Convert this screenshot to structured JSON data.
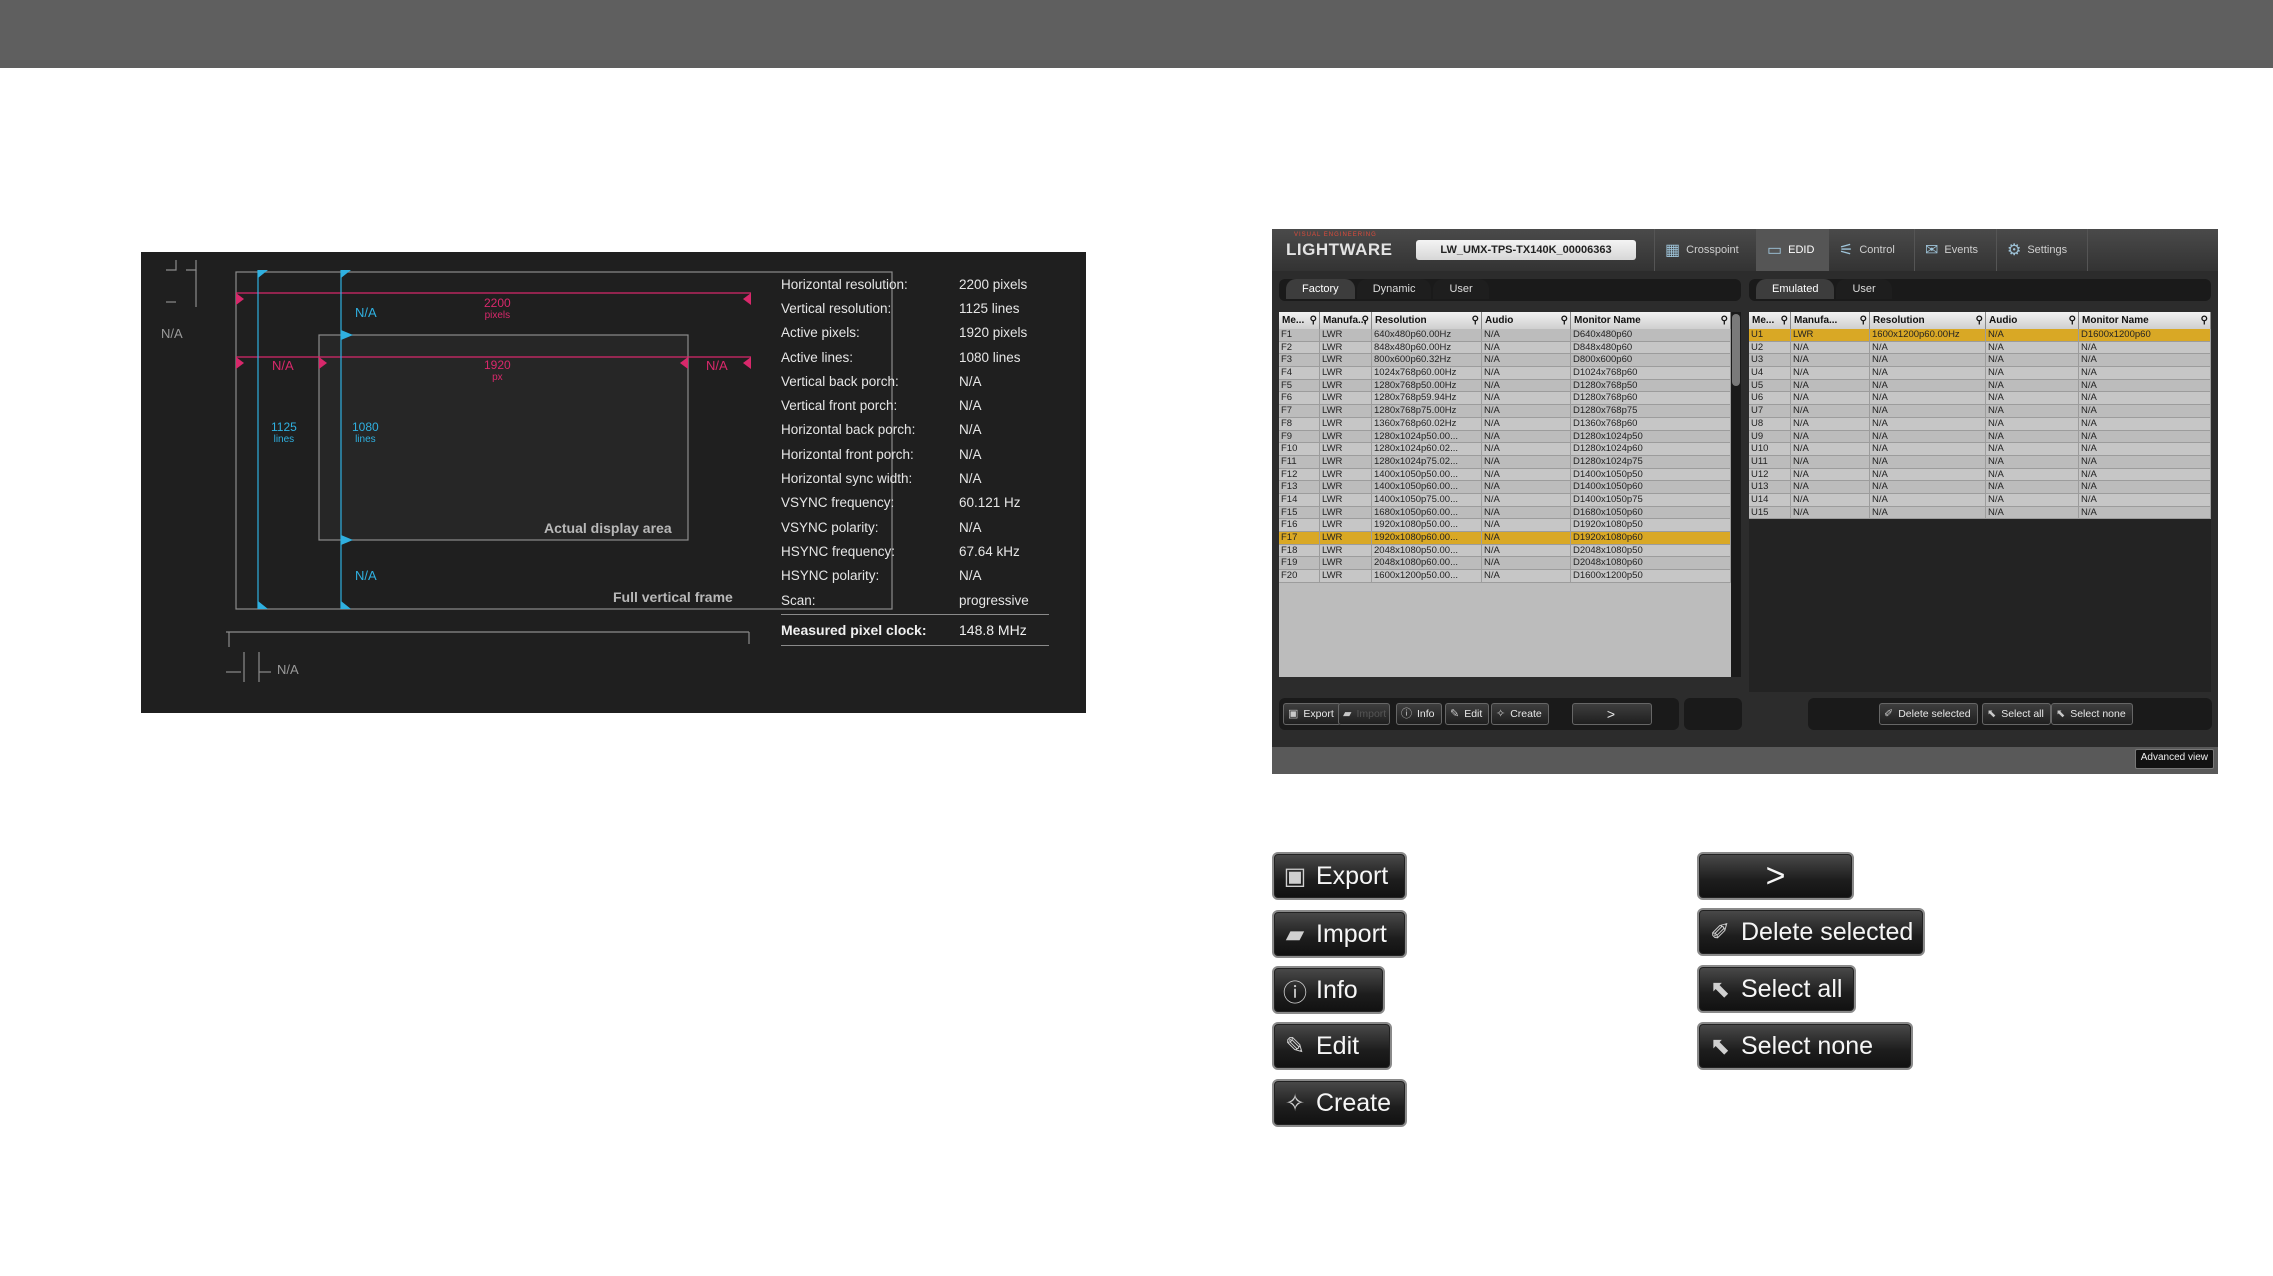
{
  "timing": {
    "labels": {
      "h_total": "2200",
      "h_total_unit": "pixels",
      "h_active": "1920",
      "h_active_unit": "px",
      "v_total": "1125",
      "v_total_unit": "lines",
      "v_active": "1080",
      "v_active_unit": "lines",
      "na": "N/A",
      "actual_area": "Actual display area",
      "full_frame": "Full vertical frame"
    },
    "params": [
      {
        "k": "Horizontal resolution:",
        "v": "2200 pixels"
      },
      {
        "k": "Vertical resolution:",
        "v": "1125 lines"
      },
      {
        "k": "Active pixels:",
        "v": "1920 pixels"
      },
      {
        "k": "Active lines:",
        "v": "1080 lines"
      },
      {
        "k": "Vertical back porch:",
        "v": "N/A"
      },
      {
        "k": "Vertical front porch:",
        "v": "N/A"
      },
      {
        "k": "Horizontal back porch:",
        "v": "N/A"
      },
      {
        "k": "Horizontal front porch:",
        "v": "N/A"
      },
      {
        "k": "Horizontal sync width:",
        "v": "N/A"
      },
      {
        "k": "VSYNC frequency:",
        "v": "60.121 Hz"
      },
      {
        "k": "VSYNC polarity:",
        "v": "N/A"
      },
      {
        "k": "HSYNC frequency:",
        "v": "67.64 kHz"
      },
      {
        "k": "HSYNC polarity:",
        "v": "N/A"
      },
      {
        "k": "Scan:",
        "v": "progressive"
      }
    ],
    "pixel_clock": {
      "k": "Measured pixel clock:",
      "v": "148.8 MHz"
    }
  },
  "app": {
    "logo": "LIGHTWARE",
    "logo_tagline": "VISUAL ENGINEERING",
    "device": "LW_UMX-TPS-TX140K_00006363",
    "nav": [
      {
        "label": "Crosspoint",
        "icon": "crosspoint-icon",
        "glyph": "▦"
      },
      {
        "label": "EDID",
        "icon": "monitor-icon",
        "glyph": "▭"
      },
      {
        "label": "Control",
        "icon": "control-icon",
        "glyph": "⚟"
      },
      {
        "label": "Events",
        "icon": "events-icon",
        "glyph": "✉"
      },
      {
        "label": "Settings",
        "icon": "gear-icon",
        "glyph": "⚙"
      }
    ],
    "left_tabs": [
      "Factory",
      "Dynamic",
      "User"
    ],
    "right_tabs": [
      "Emulated",
      "User"
    ],
    "left_columns": [
      "Me...",
      "Manufa...",
      "Resolution",
      "Audio",
      "Monitor Name"
    ],
    "right_columns": [
      "Me...",
      "Manufa...",
      "Resolution",
      "Audio",
      "Monitor Name"
    ],
    "left_rows": [
      [
        "F1",
        "LWR",
        "640x480p60.00Hz",
        "N/A",
        "D640x480p60"
      ],
      [
        "F2",
        "LWR",
        "848x480p60.00Hz",
        "N/A",
        "D848x480p60"
      ],
      [
        "F3",
        "LWR",
        "800x600p60.32Hz",
        "N/A",
        "D800x600p60"
      ],
      [
        "F4",
        "LWR",
        "1024x768p60.00Hz",
        "N/A",
        "D1024x768p60"
      ],
      [
        "F5",
        "LWR",
        "1280x768p50.00Hz",
        "N/A",
        "D1280x768p50"
      ],
      [
        "F6",
        "LWR",
        "1280x768p59.94Hz",
        "N/A",
        "D1280x768p60"
      ],
      [
        "F7",
        "LWR",
        "1280x768p75.00Hz",
        "N/A",
        "D1280x768p75"
      ],
      [
        "F8",
        "LWR",
        "1360x768p60.02Hz",
        "N/A",
        "D1360x768p60"
      ],
      [
        "F9",
        "LWR",
        "1280x1024p50.00...",
        "N/A",
        "D1280x1024p50"
      ],
      [
        "F10",
        "LWR",
        "1280x1024p60.02...",
        "N/A",
        "D1280x1024p60"
      ],
      [
        "F11",
        "LWR",
        "1280x1024p75.02...",
        "N/A",
        "D1280x1024p75"
      ],
      [
        "F12",
        "LWR",
        "1400x1050p50.00...",
        "N/A",
        "D1400x1050p50"
      ],
      [
        "F13",
        "LWR",
        "1400x1050p60.00...",
        "N/A",
        "D1400x1050p60"
      ],
      [
        "F14",
        "LWR",
        "1400x1050p75.00...",
        "N/A",
        "D1400x1050p75"
      ],
      [
        "F15",
        "LWR",
        "1680x1050p60.00...",
        "N/A",
        "D1680x1050p60"
      ],
      [
        "F16",
        "LWR",
        "1920x1080p50.00...",
        "N/A",
        "D1920x1080p50"
      ],
      [
        "F17",
        "LWR",
        "1920x1080p60.00...",
        "N/A",
        "D1920x1080p60"
      ],
      [
        "F18",
        "LWR",
        "2048x1080p50.00...",
        "N/A",
        "D2048x1080p50"
      ],
      [
        "F19",
        "LWR",
        "2048x1080p60.00...",
        "N/A",
        "D2048x1080p60"
      ],
      [
        "F20",
        "LWR",
        "1600x1200p50.00...",
        "N/A",
        "D1600x1200p50"
      ]
    ],
    "left_selected": 16,
    "right_rows": [
      [
        "U1",
        "LWR",
        "1600x1200p60.00Hz",
        "N/A",
        "D1600x1200p60"
      ],
      [
        "U2",
        "N/A",
        "N/A",
        "N/A",
        "N/A"
      ],
      [
        "U3",
        "N/A",
        "N/A",
        "N/A",
        "N/A"
      ],
      [
        "U4",
        "N/A",
        "N/A",
        "N/A",
        "N/A"
      ],
      [
        "U5",
        "N/A",
        "N/A",
        "N/A",
        "N/A"
      ],
      [
        "U6",
        "N/A",
        "N/A",
        "N/A",
        "N/A"
      ],
      [
        "U7",
        "N/A",
        "N/A",
        "N/A",
        "N/A"
      ],
      [
        "U8",
        "N/A",
        "N/A",
        "N/A",
        "N/A"
      ],
      [
        "U9",
        "N/A",
        "N/A",
        "N/A",
        "N/A"
      ],
      [
        "U10",
        "N/A",
        "N/A",
        "N/A",
        "N/A"
      ],
      [
        "U11",
        "N/A",
        "N/A",
        "N/A",
        "N/A"
      ],
      [
        "U12",
        "N/A",
        "N/A",
        "N/A",
        "N/A"
      ],
      [
        "U13",
        "N/A",
        "N/A",
        "N/A",
        "N/A"
      ],
      [
        "U14",
        "N/A",
        "N/A",
        "N/A",
        "N/A"
      ],
      [
        "U15",
        "N/A",
        "N/A",
        "N/A",
        "N/A"
      ]
    ],
    "right_selected": 0,
    "left_buttons": {
      "export": "Export",
      "import": "Import",
      "info": "Info",
      "edit": "Edit",
      "create": "Create"
    },
    "transfer_glyph": ">",
    "right_buttons": {
      "delete": "Delete selected",
      "select_all": "Select all",
      "select_none": "Select none"
    },
    "advanced_view": "Advanced view"
  },
  "legend": {
    "export": "Export",
    "import": "Import",
    "info": "Info",
    "edit": "Edit",
    "create": "Create",
    "transfer_glyph": ">",
    "delete": "Delete selected",
    "select_all": "Select all",
    "select_none": "Select none"
  },
  "colors": {
    "accent_cyan": "#2fb0e0",
    "accent_pink": "#d8286b",
    "selection": "#d9a825"
  }
}
